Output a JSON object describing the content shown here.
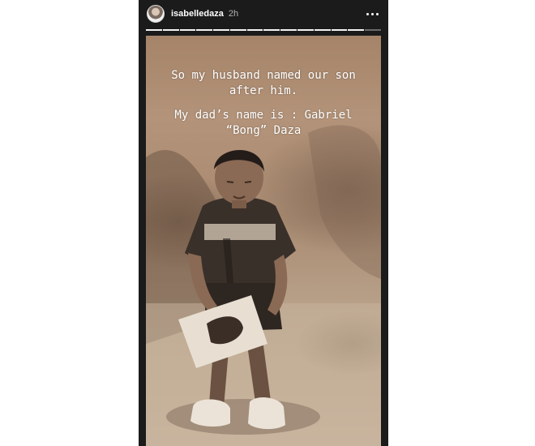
{
  "story": {
    "username": "isabelledaza",
    "time_ago": "2h",
    "segments_total": 14,
    "segments_viewed": 13
  },
  "caption": {
    "paragraph_1": "So my husband named our son after him.",
    "paragraph_2": "My dad’s name is : Gabriel “Bong” Daza"
  },
  "icons": {
    "avatar": "profile-avatar",
    "more": "more-options-icon"
  },
  "colors": {
    "story_background": "#1b1b1b",
    "page_background": "#ffffff",
    "photo_tone": "#a58469"
  }
}
